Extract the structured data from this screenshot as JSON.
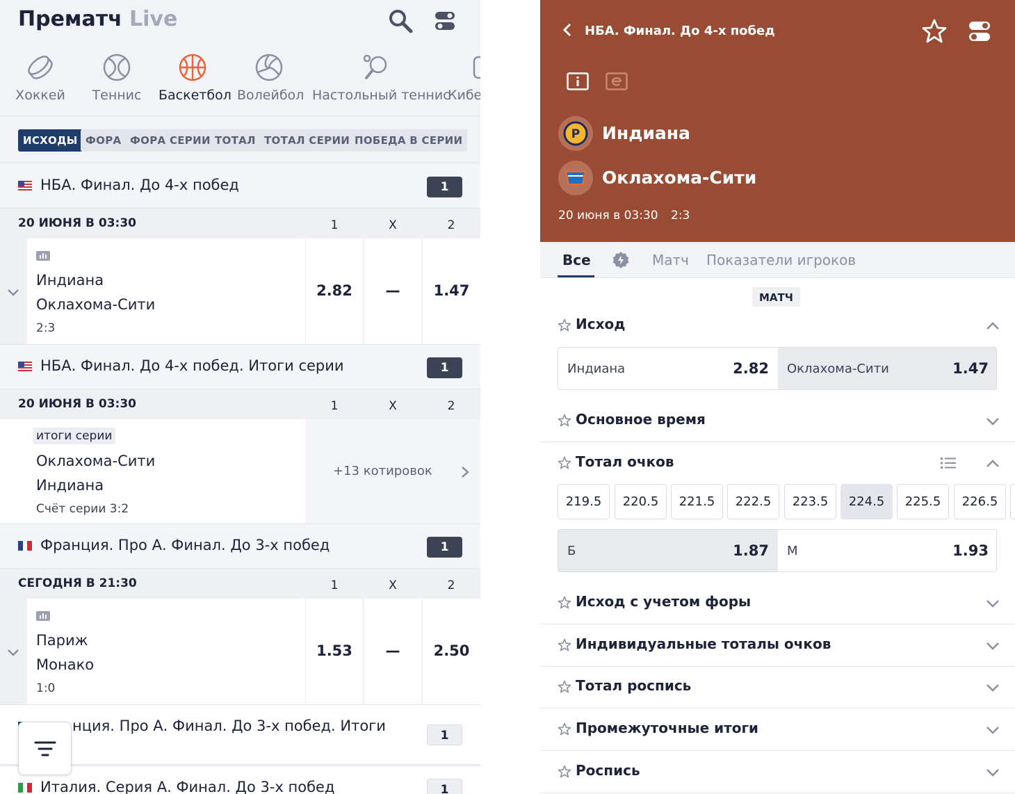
{
  "left": {
    "tabs": {
      "prematch": "Прематч",
      "live": "Live"
    },
    "sports": [
      {
        "label": "Хоккей",
        "icon": "hockey-puck-icon"
      },
      {
        "label": "Теннис",
        "icon": "tennis-ball-icon"
      },
      {
        "label": "Баскетбол",
        "icon": "basketball-icon",
        "active": true
      },
      {
        "label": "Волейбол",
        "icon": "volleyball-icon"
      },
      {
        "label": "Настольный теннис",
        "icon": "table-tennis-icon"
      },
      {
        "label": "Кибе",
        "icon": "cybersport-icon"
      }
    ],
    "filters": [
      "ИСХОДЫ",
      "ФОРА",
      "ФОРА СЕРИИ",
      "ТОТАЛ",
      "ТОТАЛ СЕРИИ",
      "ПОБЕДА В СЕРИИ"
    ],
    "col_headers": {
      "c1": "1",
      "cx": "X",
      "c2": "2"
    },
    "leagues": [
      {
        "name": "НБА. Финал. До 4-х побед",
        "count": "1",
        "date": "20 ИЮНЯ В 03:30",
        "event": {
          "team1": "Индиана",
          "team2": "Оклахома-Сити",
          "score": "2:3",
          "odd1": "2.82",
          "oddx": "—",
          "odd2": "1.47"
        }
      },
      {
        "name": "НБА. Финал. До 4-х побед. Итоги серии",
        "count": "1",
        "date": "20 ИЮНЯ В 03:30",
        "event": {
          "badge": "итоги серии",
          "team1": "Оклахома-Сити",
          "team2": "Индиана",
          "score": "Счёт серии 3:2",
          "more": "+13 котировок"
        }
      },
      {
        "name": "Франция. Про А. Финал. До 3-х побед",
        "count": "1",
        "date": "СЕГОДНЯ В 21:30",
        "event": {
          "team1": "Париж",
          "team2": "Монако",
          "score": "1:0",
          "odd1": "1.53",
          "oddx": "—",
          "odd2": "2.50"
        }
      },
      {
        "name": "нция. Про А. Финал. До 3-х побед. Итоги",
        "count": "1"
      },
      {
        "name": "Италия. Серия А. Финал. До 3-х побед",
        "count": "1"
      }
    ]
  },
  "right": {
    "title": "НБА. Финал. До 4-х побед",
    "team1": "Индиана",
    "team2": "Оклахома-Сити",
    "date": "20 июня в 03:30",
    "score": "2:3",
    "tabs": [
      "Все",
      "Матч",
      "Показатели игроков"
    ],
    "section_label": "МАТЧ",
    "markets": {
      "outcome": "Исход",
      "main_time": "Основное время",
      "total": "Тотал очков",
      "handicap": "Исход с учетом форы",
      "individual": "Индивидуальные тоталы очков",
      "total_list": "Тотал роспись",
      "intermediate": "Промежуточные итоги",
      "list": "Роспись"
    },
    "outcome": {
      "team1": "Индиана",
      "odd1": "2.82",
      "team2": "Оклахома-Сити",
      "odd2": "1.47"
    },
    "total_lines": [
      "219.5",
      "220.5",
      "221.5",
      "222.5",
      "223.5",
      "224.5",
      "225.5",
      "226.5"
    ],
    "total_selected": "224.5",
    "over_under": {
      "over_label": "Б",
      "over": "1.87",
      "under_label": "М",
      "under": "1.93"
    }
  },
  "colors": {
    "accent": "#1e3d6b",
    "hero": "#994b33",
    "basketball": "#e8643a"
  }
}
